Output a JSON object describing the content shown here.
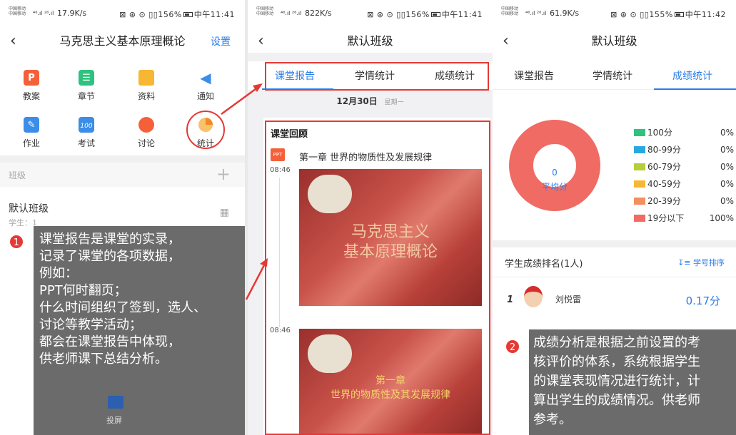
{
  "status_bars": [
    {
      "carrier": "中国移动\n中国移动",
      "signal": "⁴⁶.ıl ²⁶.ıl",
      "speed": "17.9K/s",
      "right": "⊠ ⊛ ⊙ ▯▯156%",
      "time": "中午11:41"
    },
    {
      "carrier": "中国移动\n中国移动",
      "signal": "⁴⁶.ıl ²⁶.ıl",
      "speed": "822K/s",
      "right": "⊠ ⊛ ⊙ ▯▯156%",
      "time": "中午11:41"
    },
    {
      "carrier": "中国移动\n中国移动",
      "signal": "⁴⁶.ıl ²⁶.ıl",
      "speed": "61.9K/s",
      "right": "⊠ ⊛ ⊙ ▯▯155%",
      "time": "中午11:42"
    }
  ],
  "panel1": {
    "title": "马克思主义基本原理概论",
    "settings": "设置",
    "grid": [
      {
        "label": "教案",
        "icon": "lesson-plan-icon",
        "color": "#f4603a"
      },
      {
        "label": "章节",
        "icon": "chapter-icon",
        "color": "#2ec27e"
      },
      {
        "label": "资料",
        "icon": "folder-icon",
        "color": "#f7b733"
      },
      {
        "label": "通知",
        "icon": "megaphone-icon",
        "color": "#3b8de8"
      },
      {
        "label": "作业",
        "icon": "homework-icon",
        "color": "#3b8de8"
      },
      {
        "label": "考试",
        "icon": "exam-icon",
        "color": "#3b8de8"
      },
      {
        "label": "讨论",
        "icon": "discussion-icon",
        "color": "#f4603a"
      },
      {
        "label": "统计",
        "icon": "statistics-icon",
        "color": "#f7a823"
      }
    ],
    "class_section": "班级",
    "add_symbol": "+",
    "class_name": "默认班级",
    "students": "学生：1",
    "screen_cast": "投屏",
    "callout_badge": "1",
    "callout_lines": [
      "课堂报告是课堂的实录，",
      "记录了课堂的各项数据，",
      "例如：",
      "PPT何时翻页；",
      "什么时间组织了签到，选人、",
      "讨论等教学活动；",
      "都会在课堂报告中体现，",
      "供老师课下总结分析。"
    ]
  },
  "panel2": {
    "title": "默认班级",
    "tabs": [
      "课堂报告",
      "学情统计",
      "成绩统计"
    ],
    "date": "12月30日",
    "weekday": "星期一",
    "review_heading": "课堂回顾",
    "ppt_badge": "PPT",
    "chapter_title": "第一章 世界的物质性及发展规律",
    "entries": [
      {
        "time": "08:46",
        "slide_lines": [
          "马克思主义",
          "基本原理概论"
        ]
      },
      {
        "time": "08:46",
        "slide_lines": [
          "第一章",
          "世界的物质性及其发展规律"
        ]
      }
    ]
  },
  "panel3": {
    "title": "默认班级",
    "tabs": [
      "课堂报告",
      "学情统计",
      "成绩统计"
    ],
    "donut_value": "0",
    "donut_label": "平均分",
    "legend": [
      {
        "label": "100分",
        "pct": "0%",
        "color": "#2ec27e"
      },
      {
        "label": "80-99分",
        "pct": "0%",
        "color": "#29a8e0"
      },
      {
        "label": "60-79分",
        "pct": "0%",
        "color": "#b5cf3a"
      },
      {
        "label": "40-59分",
        "pct": "0%",
        "color": "#f7b733"
      },
      {
        "label": "20-39分",
        "pct": "0%",
        "color": "#f58d5c"
      },
      {
        "label": "19分以下",
        "pct": "100%",
        "color": "#f06b63"
      }
    ],
    "ranking_heading": "学生成绩排名(1人)",
    "sort_label": "学号排序",
    "rank": "1",
    "student_name": "刘悦雷",
    "score": "0.17分",
    "callout_badge": "2",
    "callout_lines": [
      "成绩分析是根据之前设置的考",
      "核评价的体系，系统根据学生",
      "的课堂表现情况进行统计，计",
      "算出学生的成绩情况。供老师",
      "参考。"
    ]
  }
}
